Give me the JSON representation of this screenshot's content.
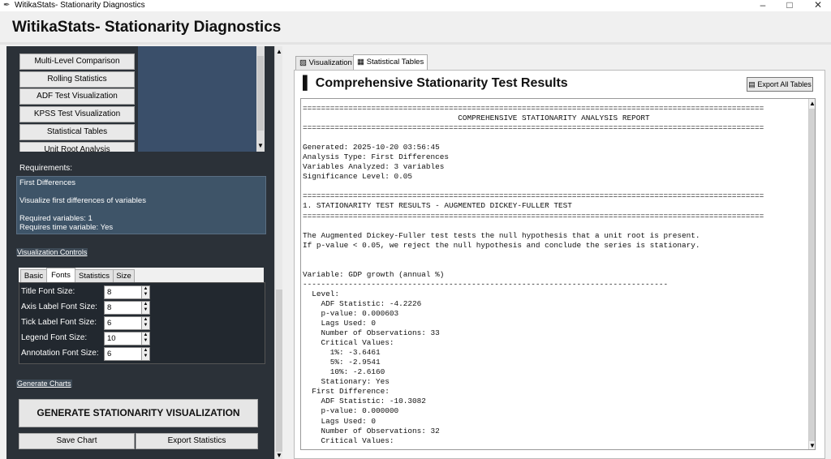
{
  "window": {
    "title": "WitikaStats- Stationarity Diagnostics",
    "minimize": "–",
    "maximize": "□",
    "close": "✕"
  },
  "header": {
    "title": "WitikaStats- Stationarity Diagnostics"
  },
  "sidebar": {
    "buttons": [
      "Multi-Level Comparison",
      "Rolling Statistics",
      "ADF Test Visualization",
      "KPSS Test Visualization",
      "Statistical Tables",
      "Unit Root Analysis"
    ],
    "requirements_label": "Requirements:",
    "requirements": {
      "title": "First Differences",
      "description": "Visualize first differences of variables",
      "required_variables": "Required variables: 1",
      "requires_time": "Requires time variable: Yes"
    },
    "viz_controls_label": "Visualization Controls",
    "tabs": [
      "Basic",
      "Fonts",
      "Statistics",
      "Size"
    ],
    "selected_tab": "Fonts",
    "font_controls": [
      {
        "label": "Title Font Size:",
        "value": "8"
      },
      {
        "label": "Axis Label Font Size:",
        "value": "8"
      },
      {
        "label": "Tick Label Font Size:",
        "value": "6"
      },
      {
        "label": "Legend Font Size:",
        "value": "10"
      },
      {
        "label": "Annotation Font Size:",
        "value": "6"
      }
    ],
    "generate_label": "Generate Charts",
    "generate_button": "GENERATE STATIONARITY VISUALIZATION",
    "save_button": "Save Chart",
    "export_stats_button": "Export Statistics"
  },
  "main": {
    "tabs": [
      {
        "icon": "▨",
        "label": "Visualization"
      },
      {
        "icon": "▦",
        "label": "Statistical Tables"
      }
    ],
    "selected_tab": "Statistical Tables",
    "title_icon": "▌",
    "title": "Comprehensive Stationarity Test Results",
    "export_all": "Export All Tables",
    "report_lines": [
      "=====================================================================================================",
      "                                  COMPREHENSIVE STATIONARITY ANALYSIS REPORT",
      "=====================================================================================================",
      "",
      "Generated: 2025-10-20 03:56:45",
      "Analysis Type: First Differences",
      "Variables Analyzed: 3 variables",
      "Significance Level: 0.05",
      "",
      "=====================================================================================================",
      "1. STATIONARITY TEST RESULTS - AUGMENTED DICKEY-FULLER TEST",
      "=====================================================================================================",
      "",
      "The Augmented Dickey-Fuller test tests the null hypothesis that a unit root is present.",
      "If p-value < 0.05, we reject the null hypothesis and conclude the series is stationary.",
      "",
      "",
      "Variable: GDP growth (annual %)",
      "--------------------------------------------------------------------------------",
      "  Level:",
      "    ADF Statistic: -4.2226",
      "    p-value: 0.000603",
      "    Lags Used: 0",
      "    Number of Observations: 33",
      "    Critical Values:",
      "      1%: -3.6461",
      "      5%: -2.9541",
      "      10%: -2.6160",
      "    Stationary: Yes",
      "  First Difference:",
      "    ADF Statistic: -10.3082",
      "    p-value: 0.000000",
      "    Lags Used: 0",
      "    Number of Observations: 32",
      "    Critical Values:"
    ]
  }
}
